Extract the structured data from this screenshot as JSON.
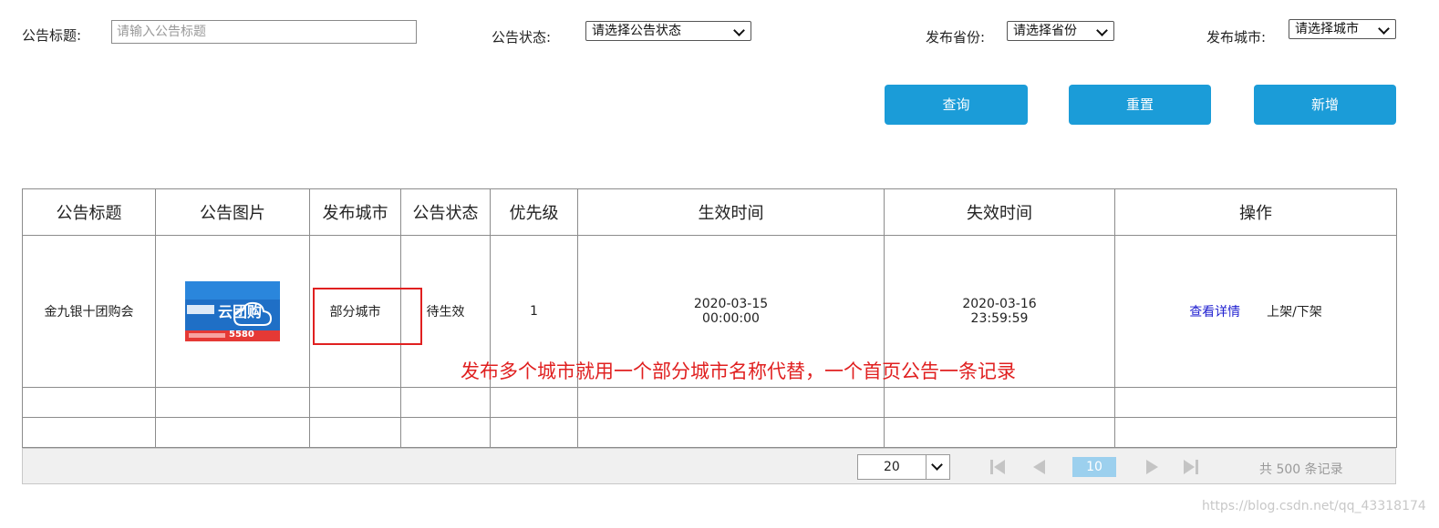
{
  "filters": {
    "title_label": "公告标题:",
    "title_placeholder": "请输入公告标题",
    "status_label": "公告状态:",
    "status_value": "请选择公告状态",
    "province_label": "发布省份:",
    "province_value": "请选择省份",
    "city_label": "发布城市:",
    "city_value": "请选择城市"
  },
  "buttons": {
    "query": "查询",
    "reset": "重置",
    "add": "新增"
  },
  "table": {
    "headers": [
      "公告标题",
      "公告图片",
      "发布城市",
      "公告状态",
      "优先级",
      "生效时间",
      "失效时间",
      "操作"
    ],
    "rows": [
      {
        "title": "金九银十团购会",
        "image_text": "云团购",
        "image_sub": "5580",
        "city": "部分城市",
        "status": "待生效",
        "priority": "1",
        "start_date": "2020-03-15",
        "start_time": "00:00:00",
        "end_date": "2020-03-16",
        "end_time": "23:59:59",
        "action_detail": "查看详情",
        "action_toggle": "上架/下架"
      }
    ]
  },
  "pager": {
    "page_size": "20",
    "current_page": "10",
    "total": "共 500 条记录"
  },
  "annotation": "发布多个城市就用一个部分城市名称代替，一个首页公告一条记录",
  "watermark": "https://blog.csdn.net/qq_43318174",
  "colors": {
    "primary_button": "#1b9cd8",
    "annotation_red": "#e02020",
    "link_blue": "#2020d0",
    "page_active": "#9cd0ee"
  }
}
